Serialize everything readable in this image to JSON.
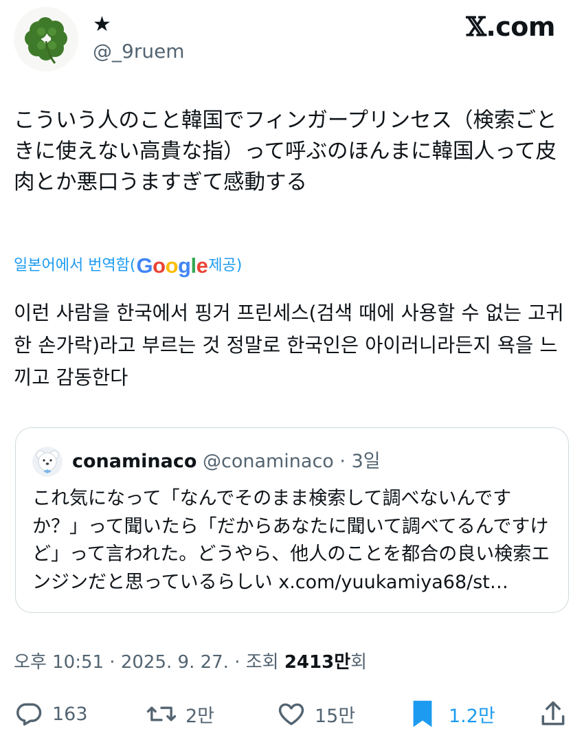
{
  "header": {
    "display_name": "★",
    "handle": "@_9ruem",
    "brand_mark": "𝕏",
    "brand_text": ".com"
  },
  "tweet": {
    "text": "こういう人のこと韓国でフィンガープリンセス（検索ごときに使えない高貴な指）って呼ぶのほんまに韓国人って皮肉とか悪口うますぎて感動する",
    "translated_prefix": "일본어에서 번역함(",
    "translated_suffix": " 제공)",
    "google_letters": [
      "G",
      "o",
      "o",
      "g",
      "l",
      "e"
    ],
    "translation": "이런 사람을 한국에서 핑거 프린세스(검색 때에 사용할 수 없는 고귀한 손가락)라고 부르는 것 정말로 한국인은 아이러니라든지 욕을 느끼고 감동한다"
  },
  "quote": {
    "name": "conaminaco",
    "meta": " @conaminaco · 3일",
    "text": "これ気になって「なんでそのまま検索して調べないんですか？」って聞いたら「だからあなたに聞いて調べてるんですけど」って言われた。どうやら、他人のことを都合の良い検索エンジンだと思っているらしい x.com/yuukamiya68/st…"
  },
  "meta": {
    "timestamp": "오후 10:51 · 2025. 9. 27. · 조회 ",
    "views": "2413만",
    "views_suffix": "회"
  },
  "actions": {
    "replies": "163",
    "reposts": "2만",
    "likes": "15만",
    "bookmarks": "1.2만"
  },
  "colors": {
    "accent": "#1d9bf0",
    "secondary_text": "#536471",
    "google": [
      "#4285F4",
      "#EA4335",
      "#FBBC05",
      "#4285F4",
      "#34A853",
      "#EA4335"
    ]
  },
  "icons": [
    "four-leaf-clover-avatar",
    "polar-bear-avatar",
    "reply-icon",
    "repost-icon",
    "like-icon",
    "bookmark-icon",
    "share-icon"
  ]
}
